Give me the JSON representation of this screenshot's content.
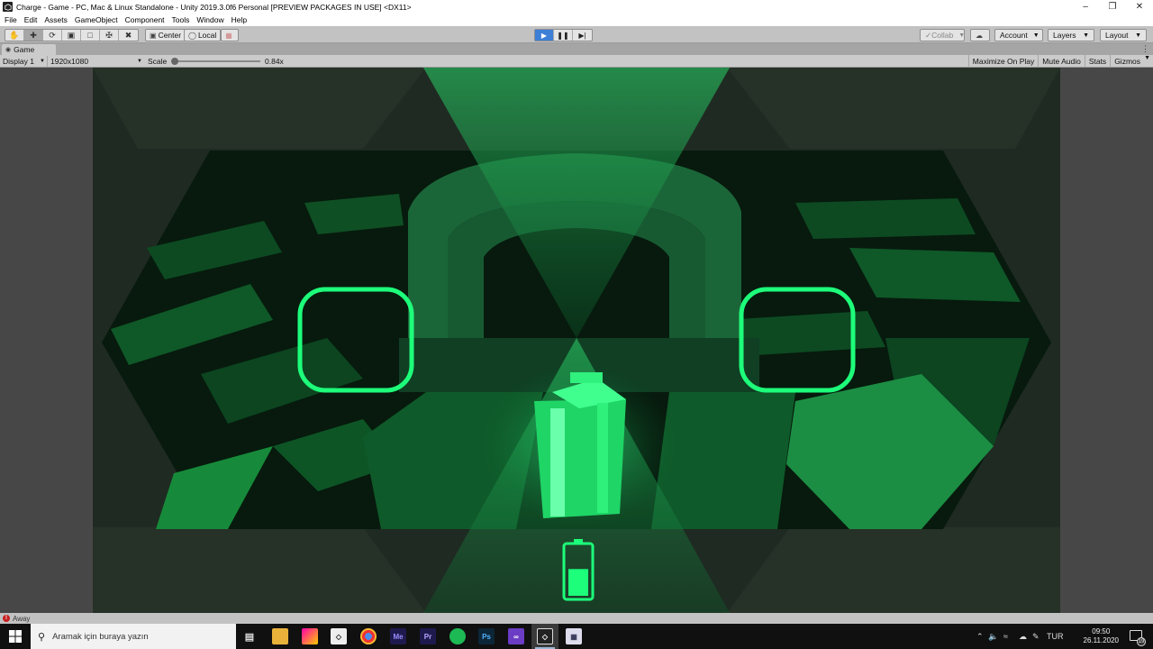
{
  "window": {
    "title": "Charge - Game - PC, Mac & Linux Standalone - Unity 2019.3.0f6 Personal [PREVIEW PACKAGES IN USE] <DX11>"
  },
  "menu": [
    "File",
    "Edit",
    "Assets",
    "GameObject",
    "Component",
    "Tools",
    "Window",
    "Help"
  ],
  "toolbar": {
    "pivot_label": "Center",
    "space_label": "Local",
    "collab_label": "Collab",
    "account_label": "Account",
    "layers_label": "Layers",
    "layout_label": "Layout"
  },
  "game_tab": {
    "label": "Game"
  },
  "game_bar": {
    "display": "Display 1",
    "resolution": "1920x1080",
    "scale_label": "Scale",
    "scale_value": "0.84x",
    "scale_fraction": 0.0,
    "maximize": "Maximize On Play",
    "mute": "Mute Audio",
    "stats": "Stats",
    "gizmos": "Gizmos"
  },
  "status": {
    "text": "Away"
  },
  "taskbar": {
    "search_placeholder": "Aramak için buraya yazın",
    "lang": "TUR",
    "time": "09:50",
    "date": "26.11.2020",
    "notifications": "19"
  },
  "colors": {
    "accent_green": "#1dff7a",
    "play_blue": "#3d7fd6",
    "battery_level": 0.55
  }
}
